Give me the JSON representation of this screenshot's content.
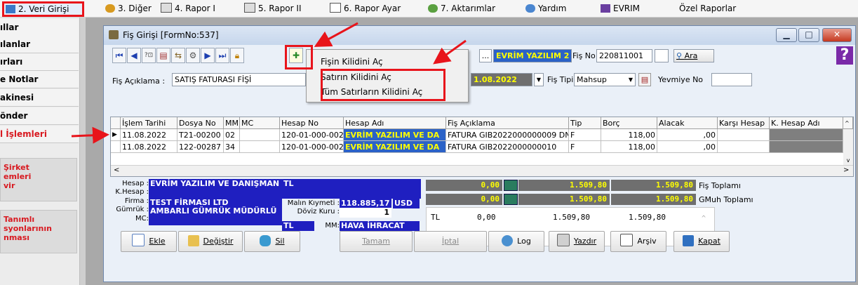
{
  "menu": {
    "items": [
      {
        "label": "2.  Veri Girişi"
      },
      {
        "label": "3.  Diğer"
      },
      {
        "label": "4.  Rapor I"
      },
      {
        "label": "5.  Rapor II"
      },
      {
        "label": "6.  Rapor Ayar"
      },
      {
        "label": "7.  Aktarımlar"
      },
      {
        "label": "Yardım"
      },
      {
        "label": "EVRIM"
      },
      {
        "label": "Özel Raporlar"
      }
    ]
  },
  "leftnav": {
    "items": [
      "ıllar",
      "ılanlar",
      "ırları",
      "e Notlar",
      "akinesi",
      "önder",
      "l İşlemleri"
    ],
    "block1": [
      "Şirket",
      "emleri",
      "vir"
    ],
    "block2": [
      "Tanımlı",
      "syonlarının",
      "nması"
    ]
  },
  "window": {
    "title": "Fiş Girişi [FormNo:537]",
    "company_field": "EVRİM YAZILIM 2",
    "fis_no_label": "Fiş No",
    "fis_no": "220811001",
    "search_label": "Ara",
    "fis_aciklama_label": "Fiş Açıklama :",
    "fis_aciklama": "SATIŞ FATURASI FİŞİ",
    "date": "1.08.2022",
    "fis_tipi_label": "Fiş  Tipi",
    "fis_tipi": "Mahsup",
    "yevmiye_label": "Yevmiye No"
  },
  "context_menu": {
    "items": [
      "Fişin Kilidini Aç",
      "Satırın Kilidini Aç",
      "Tüm Satırların Kilidini Aç"
    ]
  },
  "grid": {
    "columns": [
      "İşlem Tarihi",
      "Dosya No",
      "MM",
      "MC",
      "Hesap No",
      "Hesap Adı",
      "Fiş Açıklama",
      "Tip",
      "Borç",
      "Alacak",
      "Karşı Hesap",
      "K. Hesap Adı"
    ],
    "rows": [
      [
        "11.08.2022",
        "T21-00200",
        "02",
        "",
        "120-01-000-002",
        "EVRİM YAZILIM VE DA",
        "FATURA GIB2022000000009 DN",
        "F",
        "118,00",
        ",00",
        "",
        ""
      ],
      [
        "11.08.2022",
        "122-00287",
        "34",
        "",
        "120-01-000-002",
        "EVRİM YAZILIM VE DA",
        "FATURA GIB2022000000010",
        "F",
        "118,00",
        ",00",
        "",
        ""
      ]
    ]
  },
  "info": {
    "hesap_label": "Hesap :",
    "hesap": "EVRİM YAZILIM VE DANIŞMAN",
    "hesap_cur": "TL",
    "khesap_label": "K.Hesap :",
    "firma_label": "Firma :",
    "firma": "TEST FİRMASI LTD",
    "gumruk_label": "Gümrük :",
    "gumruk": "AMBARLI  GÜMRÜK MÜDÜRLÜ",
    "mc_label": "MC:",
    "mc_cur": "TL",
    "malin_label": "Malın Kıymeti :",
    "malin": "118.885,17",
    "malin_cur": "USD",
    "doviz_label": "Döviz Kuru :",
    "doviz": "1",
    "mm_label": "MM:",
    "mm": "HAVA İHRACAT"
  },
  "totals": {
    "row1": [
      "0,00",
      "1.509,80",
      "1.509,80"
    ],
    "row1_label": "Fiş Toplamı",
    "row2": [
      "0,00",
      "1.509,80",
      "1.509,80"
    ],
    "row2_label": "GMuh Toplamı",
    "tl_row": [
      "TL",
      "0,00",
      "1.509,80",
      "1.509,80"
    ]
  },
  "buttons": {
    "ekle": "Ekle",
    "degistir": "Değiştir",
    "sil": "Sil",
    "tamam": "Tamam",
    "iptal": "İptal",
    "log": "Log",
    "yazdir": "Yazdır",
    "arsiv": "Arşiv",
    "kapat": "Kapat"
  },
  "colors": {
    "accent_red": "#e8141b",
    "info_blue": "#1f1fc0",
    "highlight_yellow": "#ffff00"
  }
}
